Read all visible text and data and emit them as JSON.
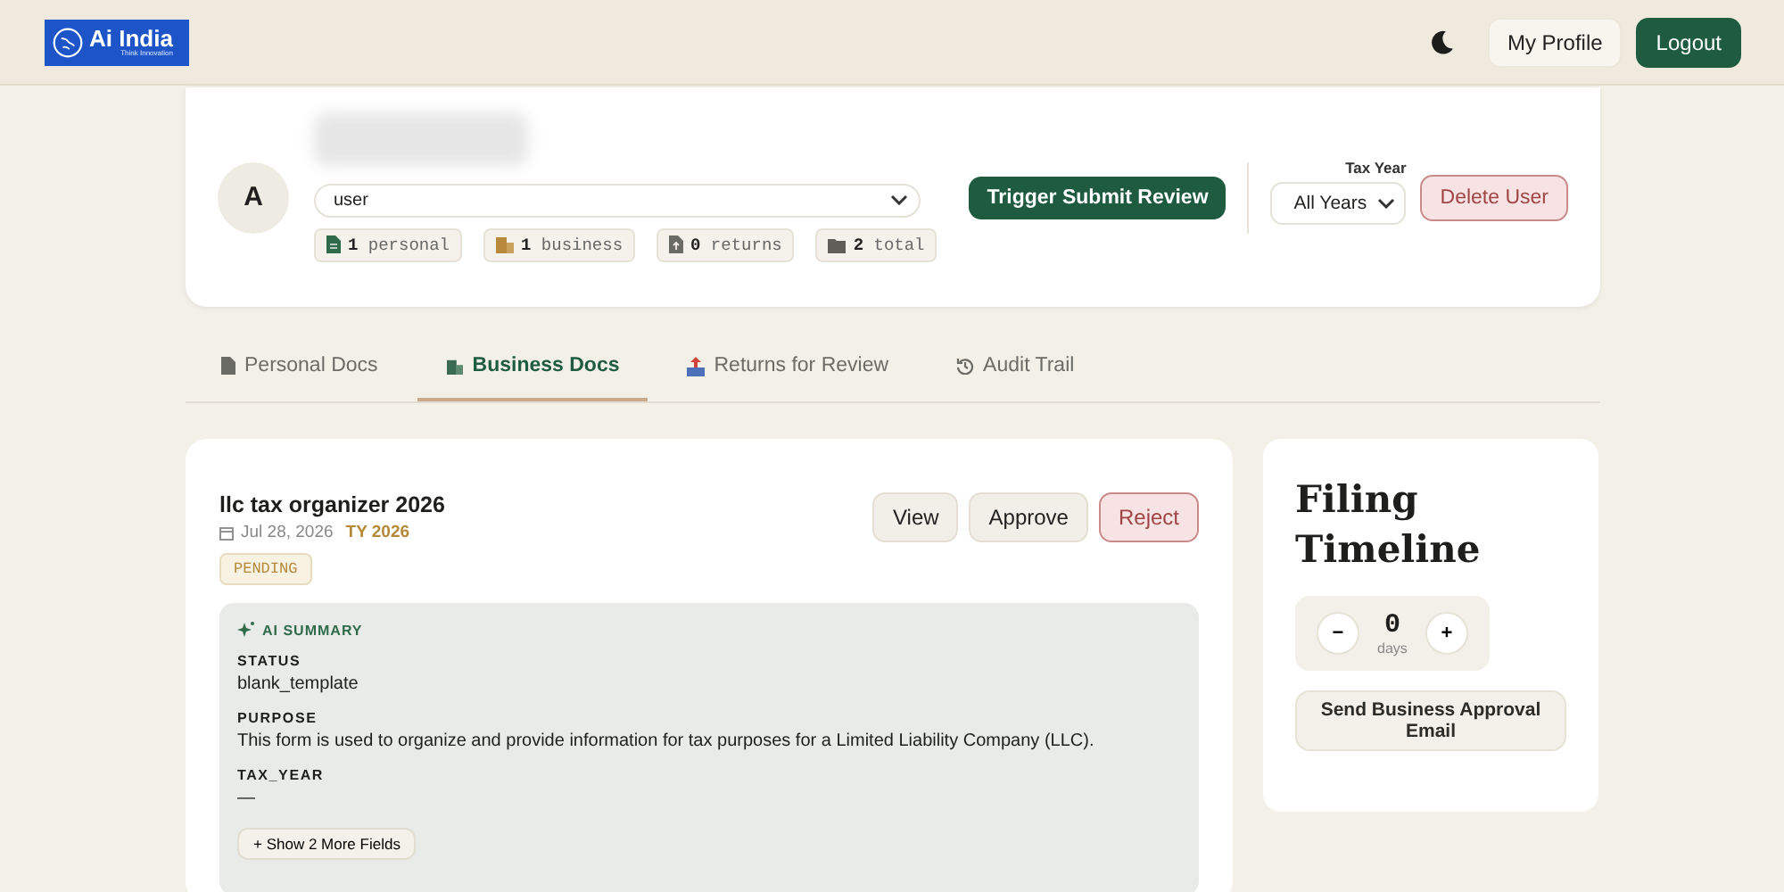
{
  "header": {
    "logo": {
      "name": "Ai India",
      "tagline": "Think Innovation"
    },
    "buttons": [
      {
        "label": "My Profile",
        "kind": "secondary"
      },
      {
        "label": "Logout",
        "kind": "primary"
      }
    ]
  },
  "profile": {
    "avatar_initial": "A",
    "role_select": "user",
    "stats": [
      {
        "count": "1",
        "label": "personal",
        "kind": "personal"
      },
      {
        "count": "1",
        "label": "business",
        "kind": "business"
      },
      {
        "count": "0",
        "label": "returns",
        "kind": "returns"
      },
      {
        "count": "2",
        "label": "total",
        "kind": "total"
      }
    ],
    "trigger_button": "Trigger Submit Review",
    "tax_year_label": "Tax Year",
    "tax_year_select": "All Years",
    "delete_button": "Delete User"
  },
  "tabs": [
    {
      "label": "Personal Docs",
      "kind": "personal",
      "selected": false
    },
    {
      "label": "Business Docs",
      "kind": "business",
      "selected": true
    },
    {
      "label": "Returns for Review",
      "kind": "returns",
      "selected": false
    },
    {
      "label": "Audit Trail",
      "kind": "audit",
      "selected": false
    }
  ],
  "document": {
    "title": "llc tax organizer 2026",
    "date": "Jul 28, 2026",
    "tax_year": "TY 2026",
    "status": "PENDING",
    "buttons": [
      {
        "label": "View",
        "kind": "neutral"
      },
      {
        "label": "Approve",
        "kind": "neutral"
      },
      {
        "label": "Reject",
        "kind": "danger"
      }
    ],
    "summary": {
      "heading": "AI SUMMARY",
      "fields": [
        {
          "label": "STATUS",
          "value": "blank_template"
        },
        {
          "label": "PURPOSE",
          "value": "This form is used to organize and provide information for tax purposes for a Limited Liability Company (LLC)."
        },
        {
          "label": "TAX_YEAR",
          "value": "—"
        }
      ],
      "more_button": "+ Show 2 More Fields"
    }
  },
  "timeline": {
    "title": "Filing Timeline",
    "decrement": "−",
    "count": "0",
    "unit": "days",
    "increment": "+",
    "send_button": "Send Business Approval Email"
  }
}
